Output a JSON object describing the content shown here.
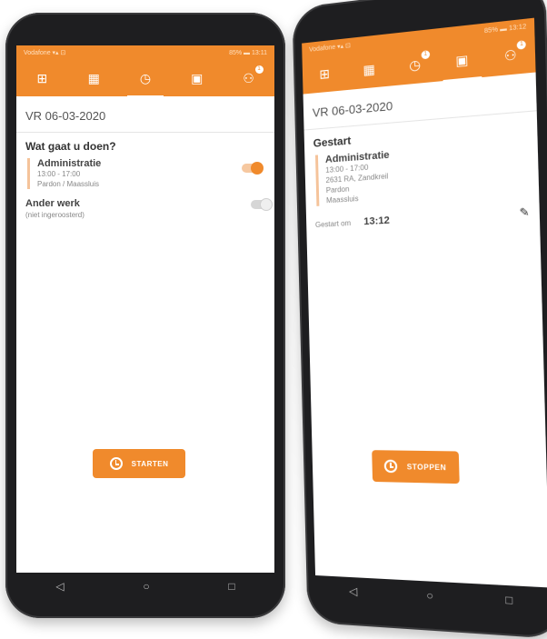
{
  "left": {
    "status_left": "Vodafone ▾▴ ⊡",
    "status_right": "85% ▬ 13:11",
    "toolbar": [
      "grid-icon",
      "calendar-icon",
      "clock-icon",
      "square-icon",
      "users-icon"
    ],
    "date": "VR 06-03-2020",
    "question": "Wat gaat u doen?",
    "activity": {
      "name": "Administratie",
      "time": "13:00 - 17:00",
      "location": "Pardon / Maassluis"
    },
    "other": {
      "name": "Ander werk",
      "sub": "(niet ingeroosterd)"
    },
    "button_label": "STARTEN",
    "nav": [
      "◁",
      "○",
      "□"
    ]
  },
  "right": {
    "status_left": "Vodafone ▾▴ ⊡",
    "status_right": "85% ▬ 13:12",
    "toolbar": [
      "grid-icon",
      "calendar-icon",
      "clock-icon",
      "square-icon",
      "users-icon"
    ],
    "date": "VR 06-03-2020",
    "section": "Gestart",
    "activity": {
      "name": "Administratie",
      "line1": "13:00 - 17:00",
      "line2": "2631 RA, Zandkreil",
      "line3": "Pardon",
      "line4": "Maassluis"
    },
    "started_label": "Gestart om",
    "started_time": "13:12",
    "button_label": "STOPPEN",
    "nav": [
      "◁",
      "○",
      "□"
    ]
  },
  "colors": {
    "accent": "#f08a2c",
    "phone_frame": "#1e1e20"
  }
}
